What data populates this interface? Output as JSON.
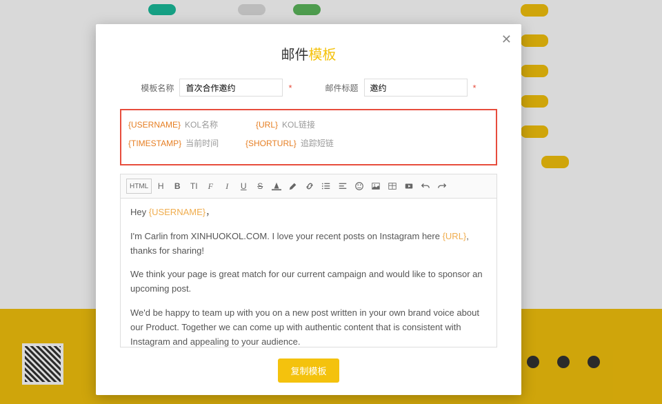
{
  "modal": {
    "title_part1": "邮件",
    "title_part2": "模板",
    "close": "✕"
  },
  "form": {
    "name_label": "模板名称",
    "name_value": "首次合作邀约",
    "subject_label": "邮件标题",
    "subject_value": "邀约",
    "required": "*"
  },
  "variables": [
    {
      "key": "{USERNAME}",
      "desc": "KOL名称"
    },
    {
      "key": "{URL}",
      "desc": "KOL链接"
    },
    {
      "key": "{TIMESTAMP}",
      "desc": "当前时间"
    },
    {
      "key": "{SHORTURL}",
      "desc": "追踪短链"
    }
  ],
  "toolbar": {
    "html": "HTML",
    "h": "H",
    "b": "B",
    "tsize": "TI",
    "font": "F",
    "i": "I",
    "u": "U",
    "s": "S"
  },
  "body": {
    "p1a": "Hey ",
    "p1ph": "{USERNAME}",
    "p1b": "，",
    "p2a": "I'm Carlin from XINHUOKOL.COM. I love your recent posts on Instagram here ",
    "p2ph": "{URL}",
    "p2b": ", thanks for sharing!",
    "p3": "We think your page is great match for our current campaign and would like to sponsor an upcoming post.",
    "p4": "We'd be happy to team up with you on a new post written in your own brand voice about our Product. Together we can come up with authentic content that is consistent with Instagram and appealing to your audience."
  },
  "copy_btn": "复制模板"
}
